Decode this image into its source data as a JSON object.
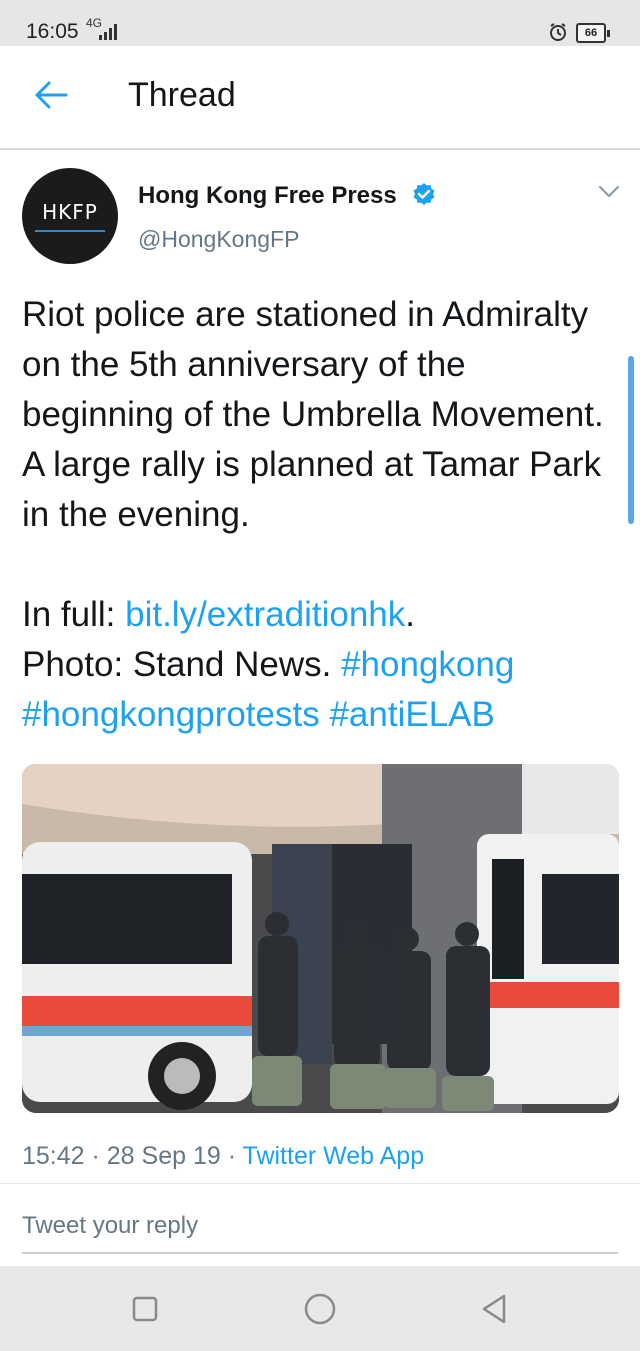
{
  "status_bar": {
    "time": "16:05",
    "network": "4G",
    "battery": "66",
    "icons": [
      "signal-icon",
      "alarm-icon",
      "battery-icon"
    ]
  },
  "header": {
    "title": "Thread",
    "back_icon": "back-arrow-icon",
    "accent_color": "#1da1f2"
  },
  "tweet": {
    "avatar_text": "HKFP",
    "author_name": "Hong Kong Free Press",
    "handle": "@HongKongFP",
    "verified": true,
    "text_line1": "Riot police are stationed in Admiralty on the 5th anniversary of the beginning of the Umbrella Movement. A large rally is planned at Tamar Park in the evening.",
    "in_full_label": "In full: ",
    "link": "bit.ly/extraditionhk",
    "link_suffix": ".",
    "photo_label": "Photo: Stand News. ",
    "hashtags": [
      "#hongkong",
      "#hongkongprotests",
      "#antiELAB"
    ],
    "photo_alt": "Riot police beside police vans at Admiralty Station",
    "time": "15:42",
    "date": "28 Sep 19",
    "source": "Twitter Web App",
    "separator": " · "
  },
  "reply": {
    "placeholder": "Tweet your reply"
  },
  "nav_bar": {
    "icons": [
      "recent-apps-icon",
      "home-icon",
      "back-icon"
    ]
  }
}
